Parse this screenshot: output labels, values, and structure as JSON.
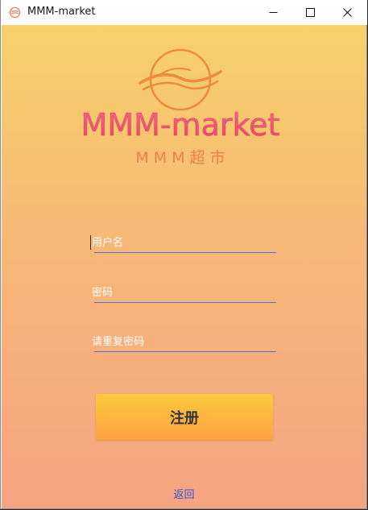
{
  "window": {
    "title": "MMM-market"
  },
  "logo": {
    "brand": "MMM-market",
    "subtitle": "M M M 超 市"
  },
  "form": {
    "username_placeholder": "用户名",
    "password_placeholder": "密码",
    "confirm_password_placeholder": "请重复密码"
  },
  "actions": {
    "register_label": "注册",
    "back_label": "返回"
  },
  "colors": {
    "bg_top": "#f7d16a",
    "bg_bottom": "#f6a382",
    "button_top": "#fec93b",
    "button_bottom": "#fca244",
    "underline": "#4d6fe0",
    "link": "#2e55d4",
    "logo_red": "#e8465b",
    "logo_orange": "#ee8a3a"
  }
}
